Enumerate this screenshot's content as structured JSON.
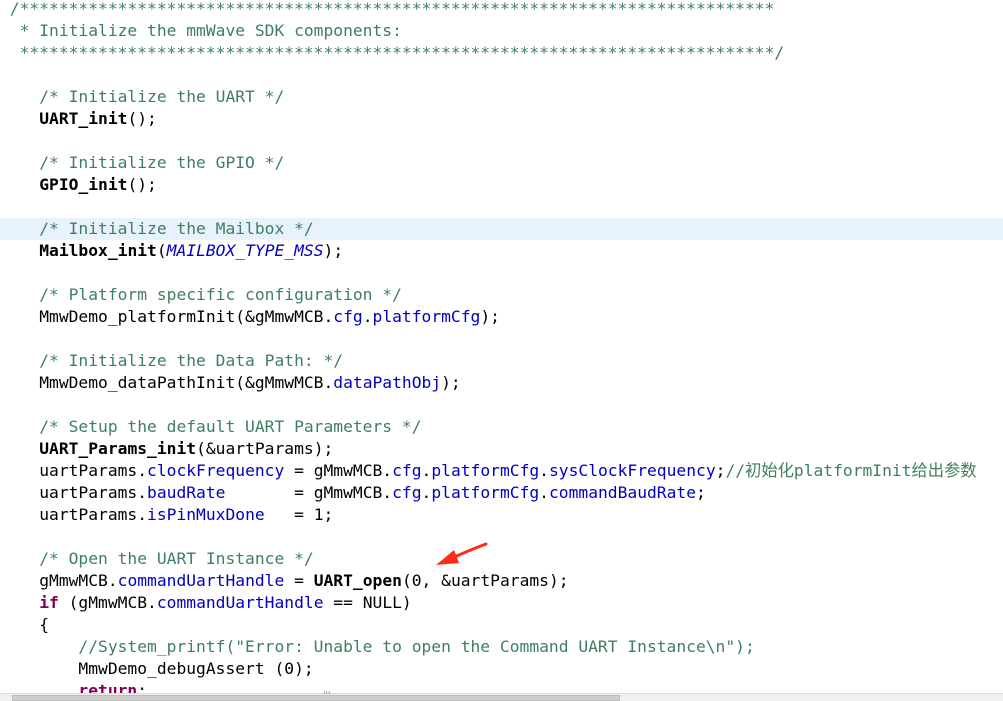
{
  "editor": {
    "language": "C",
    "current_line_index": 10,
    "lines": [
      [
        {
          "t": "c",
          "s": " /*****************************************************************************"
        }
      ],
      [
        {
          "t": "c",
          "s": "  * Initialize the mmWave SDK components:"
        }
      ],
      [
        {
          "t": "c",
          "s": "  *****************************************************************************/"
        }
      ],
      [],
      [
        {
          "t": "c",
          "s": "    /* Initialize the UART */"
        }
      ],
      [
        {
          "t": "p",
          "s": "    "
        },
        {
          "t": "fb",
          "s": "UART_init"
        },
        {
          "t": "p",
          "s": "();"
        }
      ],
      [],
      [
        {
          "t": "c",
          "s": "    /* Initialize the GPIO */"
        }
      ],
      [
        {
          "t": "p",
          "s": "    "
        },
        {
          "t": "fb",
          "s": "GPIO_init"
        },
        {
          "t": "p",
          "s": "();"
        }
      ],
      [],
      [
        {
          "t": "c",
          "s": "    /* Initialize the Mailbox */"
        }
      ],
      [
        {
          "t": "p",
          "s": "    "
        },
        {
          "t": "fb",
          "s": "Mailbox_init"
        },
        {
          "t": "p",
          "s": "("
        },
        {
          "t": "m",
          "s": "MAILBOX_TYPE_MSS"
        },
        {
          "t": "p",
          "s": ");"
        }
      ],
      [],
      [
        {
          "t": "c",
          "s": "    /* Platform specific configuration */"
        }
      ],
      [
        {
          "t": "p",
          "s": "    MmwDemo_platformInit(&gMmwMCB."
        },
        {
          "t": "f",
          "s": "cfg"
        },
        {
          "t": "p",
          "s": "."
        },
        {
          "t": "f",
          "s": "platformCfg"
        },
        {
          "t": "p",
          "s": ");"
        }
      ],
      [],
      [
        {
          "t": "c",
          "s": "    /* Initialize the Data Path: */"
        }
      ],
      [
        {
          "t": "p",
          "s": "    MmwDemo_dataPathInit(&gMmwMCB."
        },
        {
          "t": "f",
          "s": "dataPathObj"
        },
        {
          "t": "p",
          "s": ");"
        }
      ],
      [],
      [
        {
          "t": "c",
          "s": "    /* Setup the default UART Parameters */"
        }
      ],
      [
        {
          "t": "p",
          "s": "    "
        },
        {
          "t": "fb",
          "s": "UART_Params_init"
        },
        {
          "t": "p",
          "s": "(&uartParams);"
        }
      ],
      [
        {
          "t": "p",
          "s": "    uartParams."
        },
        {
          "t": "f",
          "s": "clockFrequency"
        },
        {
          "t": "p",
          "s": " = gMmwMCB."
        },
        {
          "t": "f",
          "s": "cfg"
        },
        {
          "t": "p",
          "s": "."
        },
        {
          "t": "f",
          "s": "platformCfg"
        },
        {
          "t": "p",
          "s": "."
        },
        {
          "t": "f",
          "s": "sysClockFrequency"
        },
        {
          "t": "p",
          "s": ";"
        },
        {
          "t": "c",
          "s": "//初始化platformInit给出参数"
        }
      ],
      [
        {
          "t": "p",
          "s": "    uartParams."
        },
        {
          "t": "f",
          "s": "baudRate"
        },
        {
          "t": "p",
          "s": "       = gMmwMCB."
        },
        {
          "t": "f",
          "s": "cfg"
        },
        {
          "t": "p",
          "s": "."
        },
        {
          "t": "f",
          "s": "platformCfg"
        },
        {
          "t": "p",
          "s": "."
        },
        {
          "t": "f",
          "s": "commandBaudRate"
        },
        {
          "t": "p",
          "s": ";"
        }
      ],
      [
        {
          "t": "p",
          "s": "    uartParams."
        },
        {
          "t": "f",
          "s": "isPinMuxDone"
        },
        {
          "t": "p",
          "s": "   = 1;"
        }
      ],
      [],
      [
        {
          "t": "c",
          "s": "    /* Open the UART Instance */"
        }
      ],
      [
        {
          "t": "p",
          "s": "    gMmwMCB."
        },
        {
          "t": "f",
          "s": "commandUartHandle"
        },
        {
          "t": "p",
          "s": " = "
        },
        {
          "t": "fb",
          "s": "UART_open"
        },
        {
          "t": "p",
          "s": "(0, &uartParams);"
        }
      ],
      [
        {
          "t": "p",
          "s": "    "
        },
        {
          "t": "k",
          "s": "if"
        },
        {
          "t": "p",
          "s": " (gMmwMCB."
        },
        {
          "t": "f",
          "s": "commandUartHandle"
        },
        {
          "t": "p",
          "s": " == NULL)"
        }
      ],
      [
        {
          "t": "p",
          "s": "    {"
        }
      ],
      [
        {
          "t": "p",
          "s": "        "
        },
        {
          "t": "c",
          "s": "//System_printf(\"Error: Unable to open the Command UART Instance\\n\");"
        }
      ],
      [
        {
          "t": "p",
          "s": "        MmwDemo_debugAssert (0);"
        }
      ],
      [
        {
          "t": "p",
          "s": "        "
        },
        {
          "t": "k",
          "s": "return"
        },
        {
          "t": "p",
          "s": ";"
        }
      ]
    ]
  },
  "annotation": {
    "arrow_color": "#ff2a1a",
    "icon": "red-arrow-icon"
  },
  "scrollbar": {
    "grip_label": "'''"
  }
}
